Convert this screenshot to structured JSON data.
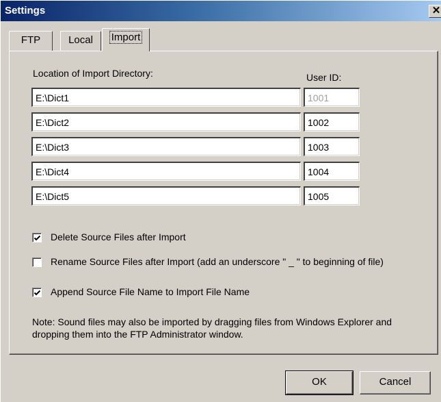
{
  "window": {
    "title": "Settings",
    "close_glyph": "✕"
  },
  "tabs": [
    {
      "label": "FTP",
      "active": false
    },
    {
      "label": "Local",
      "active": false
    },
    {
      "label": "Import",
      "active": true
    }
  ],
  "import": {
    "location_label": "Location of Import Directory:",
    "user_id_label": "User ID:",
    "rows": [
      {
        "path": "E:\\Dict1",
        "user_id": "1001",
        "user_id_disabled": true
      },
      {
        "path": "E:\\Dict2",
        "user_id": "1002",
        "user_id_disabled": false
      },
      {
        "path": "E:\\Dict3",
        "user_id": "1003",
        "user_id_disabled": false
      },
      {
        "path": "E:\\Dict4",
        "user_id": "1004",
        "user_id_disabled": false
      },
      {
        "path": "E:\\Dict5",
        "user_id": "1005",
        "user_id_disabled": false
      }
    ],
    "options": [
      {
        "label": "Delete Source Files after Import",
        "checked": true
      },
      {
        "label": "Rename Source Files after Import (add an underscore \" _ \" to beginning of file)",
        "checked": false
      },
      {
        "label": "Append Source File Name to Import File Name",
        "checked": true
      }
    ],
    "note": "Note:  Sound files may also be imported by dragging files from Windows Explorer and dropping them into the FTP Administrator window."
  },
  "buttons": {
    "ok": "OK",
    "cancel": "Cancel"
  }
}
